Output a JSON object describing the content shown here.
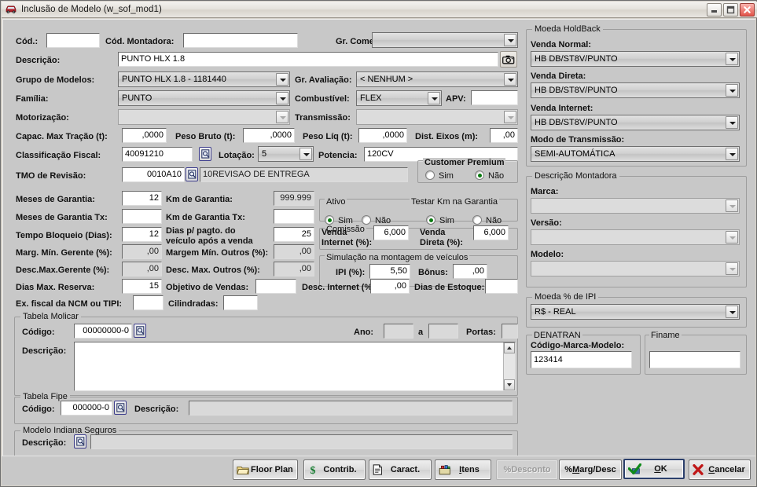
{
  "window": {
    "title": "Inclusão de Modelo (w_sof_mod1)",
    "icon": "car-icon",
    "minimize_label": "Minimizar",
    "maximize_label": "Maximizar",
    "close_label": "Fechar"
  },
  "main": {
    "cod_label": "Cód.:",
    "cod_value": "",
    "cod_montadora_label": "Cód. Montadora:",
    "cod_montadora_value": "",
    "gr_comercial_label": "Gr. Comercial:",
    "gr_comercial_value": "",
    "descricao_label": "Descrição:",
    "descricao_value": "PUNTO HLX 1.8",
    "camera_icon": "camera-icon",
    "grupo_modelos_label": "Grupo de Modelos:",
    "grupo_modelos_value": "PUNTO HLX 1.8 - 1181440",
    "gr_avaliacao_label": "Gr. Avaliação:",
    "gr_avaliacao_value": "< NENHUM >",
    "familia_label": "Família:",
    "familia_value": "PUNTO",
    "combustivel_label": "Combustível:",
    "combustivel_value": "FLEX",
    "apv_label": "APV:",
    "apv_value": "",
    "motorizacao_label": "Motorização:",
    "motorizacao_value": "",
    "transmissao_label": "Transmissão:",
    "transmissao_value": "",
    "capac_max_tracao_label": "Capac. Max Tração (t):",
    "capac_max_tracao_value": ",0000",
    "peso_bruto_label": "Peso Bruto (t):",
    "peso_bruto_value": ",0000",
    "peso_liq_label": "Peso Líq (t):",
    "peso_liq_value": ",0000",
    "dist_eixos_label": "Dist. Eixos (m):",
    "dist_eixos_value": ",00",
    "classificacao_fiscal_label": "Classificação Fiscal:",
    "classificacao_fiscal_value": "40091210",
    "classificacao_fiscal_lookup": "lookup-icon",
    "lotacao_label": "Lotação:",
    "lotacao_value": "5",
    "potencia_label": "Potencia:",
    "potencia_value": "120CV",
    "customer_premium_label": "Customer Premium",
    "customer_premium_sim": "Sim",
    "customer_premium_nao": "Não",
    "customer_premium_selected": "Não",
    "tmo_revisao_label": "TMO de Revisão:",
    "tmo_revisao_value": "0010A10",
    "tmo_revisao_lookup": "lookup-icon",
    "tmo_revisao_desc": "10REVISAO DE ENTREGA",
    "meses_garantia_label": "Meses de Garantia:",
    "meses_garantia_value": "12",
    "km_garantia_label": "Km de Garantia:",
    "km_garantia_value": "999.999",
    "ativo_label": "Ativo",
    "ativo_sim": "Sim",
    "ativo_nao": "Não",
    "ativo_selected": "Sim",
    "testar_km_label": "Testar Km na Garantia",
    "testar_km_sim": "Sim",
    "testar_km_nao": "Não",
    "testar_km_selected": "Sim",
    "meses_garantia_tx_label": "Meses de Garantia Tx:",
    "meses_garantia_tx_value": "",
    "km_garantia_tx_label": "Km de Garantia Tx:",
    "km_garantia_tx_value": "",
    "comissao_label": "Comissão",
    "tempo_bloqueio_label": "Tempo Bloqueio (Dias):",
    "tempo_bloqueio_value": "12",
    "dias_pagto_label_1": "Dias p/ pagto. do",
    "dias_pagto_label_2": "veículo após a venda",
    "dias_pagto_value": "25",
    "venda_internet_label_1": "Venda",
    "venda_internet_label_2": "Internet (%):",
    "venda_internet_value": "6,000",
    "venda_direta_label_1": "Venda",
    "venda_direta_label_2": "Direta (%):",
    "venda_direta_value": "6,000",
    "marg_min_gerente_label": "Marg. Mín. Gerente (%):",
    "marg_min_gerente_value": ",00",
    "margem_min_outros_label": "Margem Mín. Outros (%):",
    "margem_min_outros_value": ",00",
    "simulacao_label": "Simulação na montagem de veículos",
    "desc_max_gerente_label": "Desc.Max.Gerente (%):",
    "desc_max_gerente_value": ",00",
    "desc_max_outros_label": "Desc. Max. Outros (%):",
    "desc_max_outros_value": ",00",
    "ipi_label": "IPI (%):",
    "ipi_value": "5,50",
    "bonus_label": "Bônus:",
    "bonus_value": ",00",
    "dias_max_reserva_label": "Dias Max. Reserva:",
    "dias_max_reserva_value": "15",
    "objetivo_vendas_label": "Objetivo de Vendas:",
    "objetivo_vendas_value": "",
    "desc_internet_label": "Desc. Internet (%):",
    "desc_internet_value": ",00",
    "dias_estoque_label": "Dias de Estoque:",
    "dias_estoque_value": "",
    "ex_fiscal_label": "Ex. fiscal da NCM ou TIPI:",
    "ex_fiscal_value": "",
    "cilindradas_label": "Cilindradas:",
    "cilindradas_value": ""
  },
  "molicar": {
    "group_title": "Tabela Molicar",
    "codigo_label": "Código:",
    "codigo_value": "00000000-0",
    "codigo_lookup": "lookup-icon",
    "ano_label": "Ano:",
    "ano_de_value": "",
    "ano_a_label": "a",
    "ano_ate_value": "",
    "portas_label": "Portas:",
    "portas_value": "",
    "descricao_label": "Descrição:",
    "descricao_value": ""
  },
  "fipe": {
    "group_title": "Tabela Fipe",
    "codigo_label": "Código:",
    "codigo_value": "000000-0",
    "codigo_lookup": "lookup-icon",
    "descricao_label": "Descrição:",
    "descricao_value": ""
  },
  "indiana": {
    "group_title": "Modelo Indiana Seguros",
    "descricao_label": "Descrição:",
    "descricao_lookup": "lookup-icon",
    "descricao_value": ""
  },
  "sidebar": {
    "holdback_group": "Moeda HoldBack",
    "venda_normal_label": "Venda Normal:",
    "venda_normal_value": "HB DB/ST8V/PUNTO",
    "venda_direta_label": "Venda Direta:",
    "venda_direta_value": "HB DB/ST8V/PUNTO",
    "venda_internet_label": "Venda Internet:",
    "venda_internet_value": "HB DB/ST8V/PUNTO",
    "modo_transmissao_label": "Modo de Transmissão:",
    "modo_transmissao_value": "SEMI-AUTOMÁTICA",
    "montadora_group": "Descrição Montadora",
    "marca_label": "Marca:",
    "marca_value": "",
    "versao_label": "Versão:",
    "versao_value": "",
    "modelo_label": "Modelo:",
    "modelo_value": "",
    "moeda_ipi_group": "Moeda % de IPI",
    "moeda_ipi_value": "R$   - REAL",
    "denatran_label": "DENATRAN",
    "denatran_codigo_label": "Código-Marca-Modelo:",
    "denatran_codigo_value": "123414",
    "finame_label": "Finame",
    "finame_value": ""
  },
  "buttons": {
    "floor_plan": "Floor Plan",
    "floor_plan_icon": "folder-icon",
    "contrib": "Contrib.",
    "contrib_icon": "dollar-icon",
    "caract": "Caract.",
    "caract_icon": "document-icon",
    "itens": "Itens",
    "itens_icon": "items-icon",
    "desconto": "%Desconto",
    "marg_desc": "%Marg/Desc",
    "ok": "OK",
    "ok_icon": "check-icon",
    "cancelar": "Cancelar",
    "cancelar_icon": "x-icon"
  },
  "colors": {
    "window_bg": "#c8c8c8",
    "field_bg": "#ffffff",
    "readonly_bg": "#d9d9d9",
    "radio_dot": "#0a7a10",
    "close_btn": "#e2554a"
  }
}
